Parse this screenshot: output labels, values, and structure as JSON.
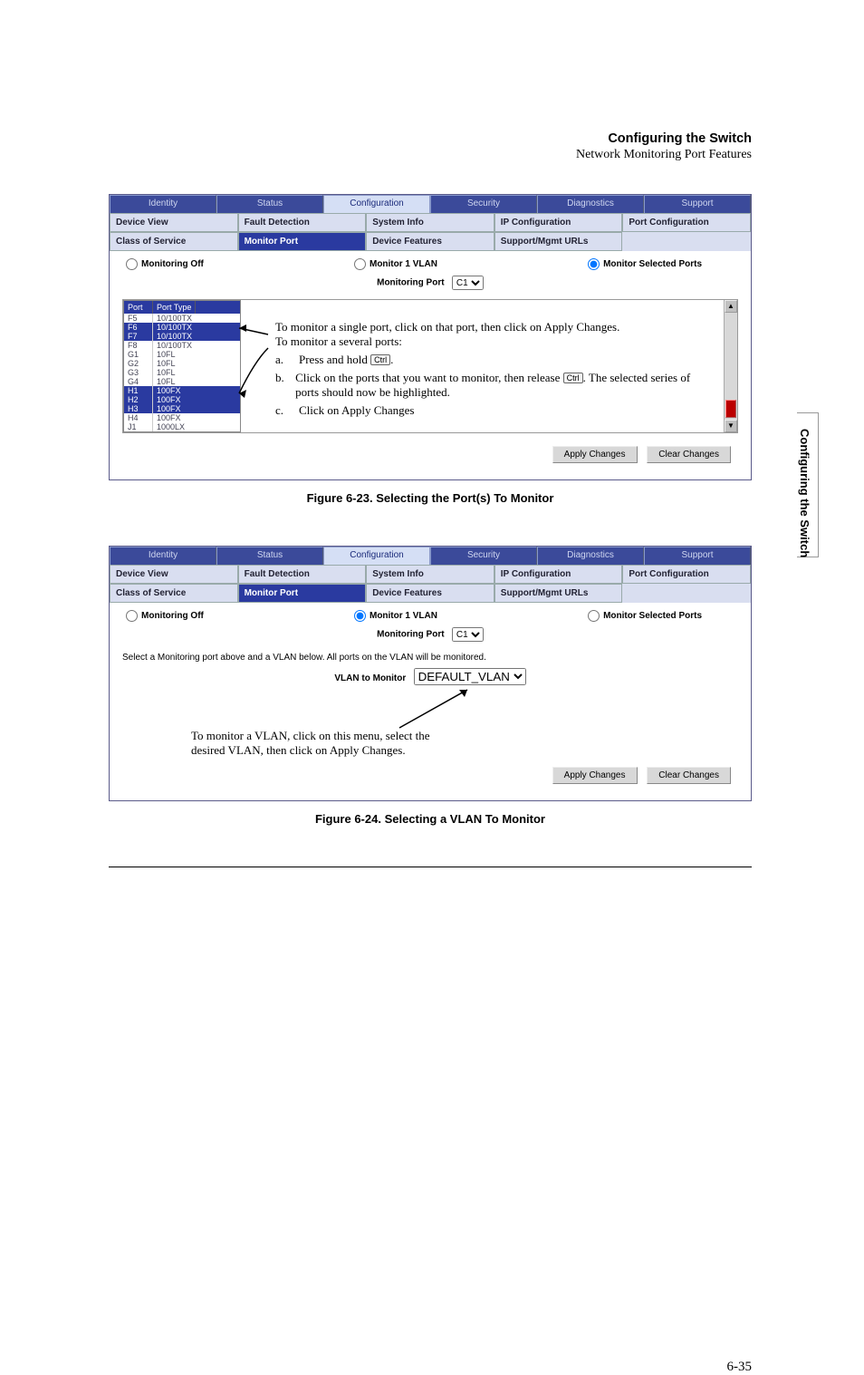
{
  "header": {
    "title": "Configuring the Switch",
    "subtitle": "Network Monitoring Port Features"
  },
  "side_tab": "Configuring the Switch",
  "page_number": "6-35",
  "main_tabs": [
    "Identity",
    "Status",
    "Configuration",
    "Security",
    "Diagnostics",
    "Support"
  ],
  "sub_tabs_row1": [
    "Device View",
    "Fault Detection",
    "System Info",
    "IP Configuration",
    "Port Configuration"
  ],
  "sub_tabs_row2": [
    "Class of Service",
    "Monitor Port",
    "Device Features",
    "Support/Mgmt URLs",
    ""
  ],
  "radios": {
    "off": "Monitoring Off",
    "vlan": "Monitor 1 VLAN",
    "ports": "Monitor Selected Ports"
  },
  "monitoring_port_label": "Monitoring Port",
  "monitoring_port_value": "C1",
  "vlan_label": "VLAN to Monitor",
  "vlan_value": "DEFAULT_VLAN",
  "vlan_note": "Select a Monitoring port above and a VLAN below. All ports on the VLAN will be monitored.",
  "port_table": {
    "headers": [
      "Port",
      "Port Type"
    ],
    "rows": [
      {
        "p": "F5",
        "t": "10/100TX",
        "sel": false
      },
      {
        "p": "F6",
        "t": "10/100TX",
        "sel": true
      },
      {
        "p": "F7",
        "t": "10/100TX",
        "sel": true
      },
      {
        "p": "F8",
        "t": "10/100TX",
        "sel": false
      },
      {
        "p": "G1",
        "t": "10FL",
        "sel": false
      },
      {
        "p": "G2",
        "t": "10FL",
        "sel": false
      },
      {
        "p": "G3",
        "t": "10FL",
        "sel": false
      },
      {
        "p": "G4",
        "t": "10FL",
        "sel": false
      },
      {
        "p": "H1",
        "t": "100FX",
        "sel": true
      },
      {
        "p": "H2",
        "t": "100FX",
        "sel": true
      },
      {
        "p": "H3",
        "t": "100FX",
        "sel": true
      },
      {
        "p": "H4",
        "t": "100FX",
        "sel": false
      },
      {
        "p": "J1",
        "t": "1000LX",
        "sel": false
      }
    ]
  },
  "annotation": {
    "line1": "To monitor a single port, click on that port, then click on Apply Changes.",
    "line2": "To monitor a several ports:",
    "a_pre": "Press and hold ",
    "a_key": "Ctrl",
    "a_post": ".",
    "b_pre": "Click on the ports that you want to monitor, then release ",
    "b_key": "Ctrl",
    "b_post": ". The selected series of ports should now be highlighted.",
    "c": "Click on Apply Changes"
  },
  "buttons": {
    "apply": "Apply Changes",
    "clear": "Clear Changes"
  },
  "figure1_caption": "Figure 6-23.  Selecting the Port(s) To Monitor",
  "figure2_caption": "Figure 6-24.  Selecting a VLAN To Monitor",
  "vlan_callout": "To monitor a VLAN, click on this menu, select the desired VLAN, then click on Apply Changes."
}
